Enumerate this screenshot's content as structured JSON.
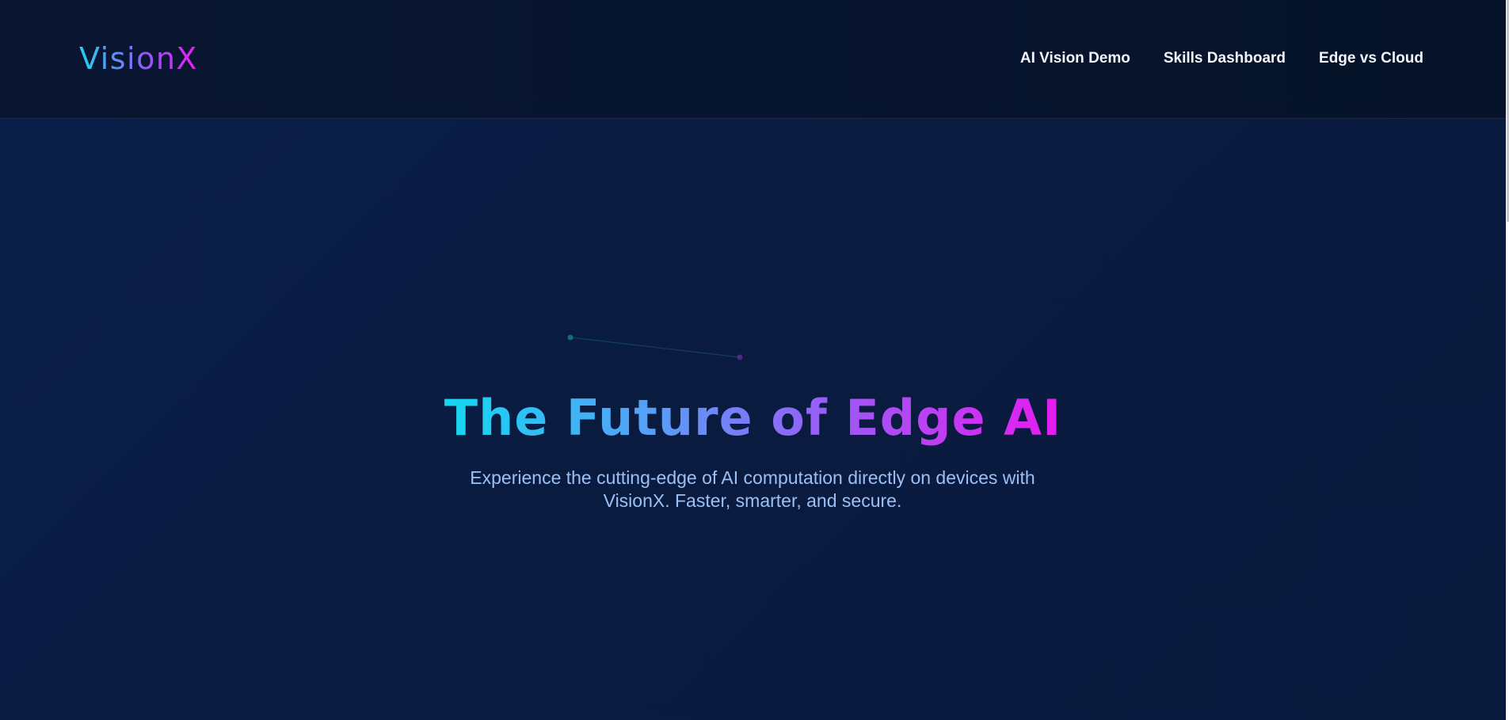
{
  "header": {
    "logo": "VisionX",
    "nav": [
      {
        "label": "AI Vision Demo"
      },
      {
        "label": "Skills Dashboard"
      },
      {
        "label": "Edge vs Cloud"
      }
    ]
  },
  "hero": {
    "title": "The Future of Edge AI",
    "subtitle": "Experience the cutting-edge of AI computation directly on devices with VisionX. Faster, smarter, and secure."
  },
  "colors": {
    "background": "#0a1b40",
    "header_background": "#08152f",
    "gradient_start": "#22d3ee",
    "gradient_mid": "#8b5cf6",
    "gradient_end": "#ec1cf2",
    "subtitle_text": "#9cc0f4",
    "nav_text": "#f2f5fb"
  }
}
